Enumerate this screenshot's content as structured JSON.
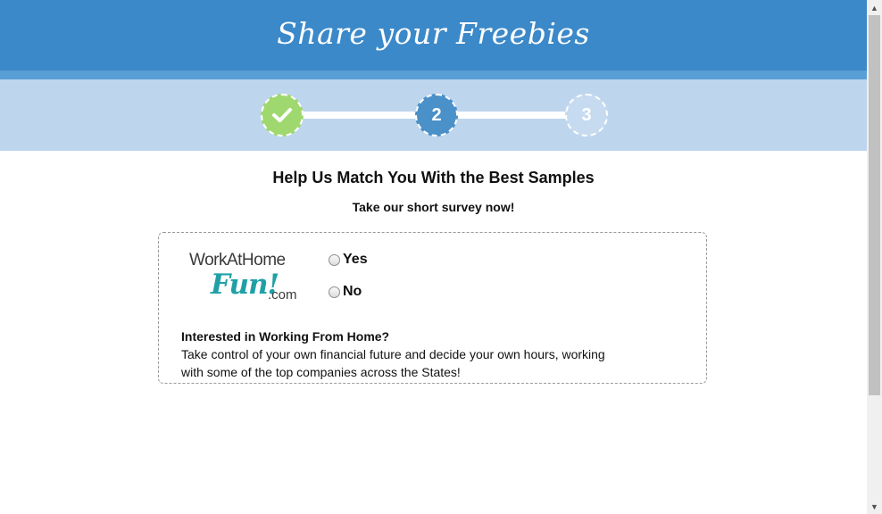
{
  "header": {
    "title": "Share your Freebies"
  },
  "steps": [
    {
      "state": "completed",
      "icon": "check-icon"
    },
    {
      "state": "current",
      "label": "2"
    },
    {
      "state": "upcoming",
      "label": "3"
    }
  ],
  "colors": {
    "header_bg": "#3b89c9",
    "stepbar_bg": "#bed5ee",
    "step_completed": "#9fd86e",
    "step_current": "#4a90c9",
    "logo_accent": "#1fa0a6"
  },
  "survey": {
    "headline": "Help Us Match You With the Best Samples",
    "subline": "Take our short survey now!"
  },
  "offer": {
    "logo": {
      "top": "WorkAtHome",
      "fun": "Fun!",
      "com": ".com"
    },
    "options": [
      "Yes",
      "No"
    ],
    "title": "Interested in Working From Home?",
    "description": "Take control of your own financial future and decide your own hours, working with some of the top companies across the States!"
  }
}
